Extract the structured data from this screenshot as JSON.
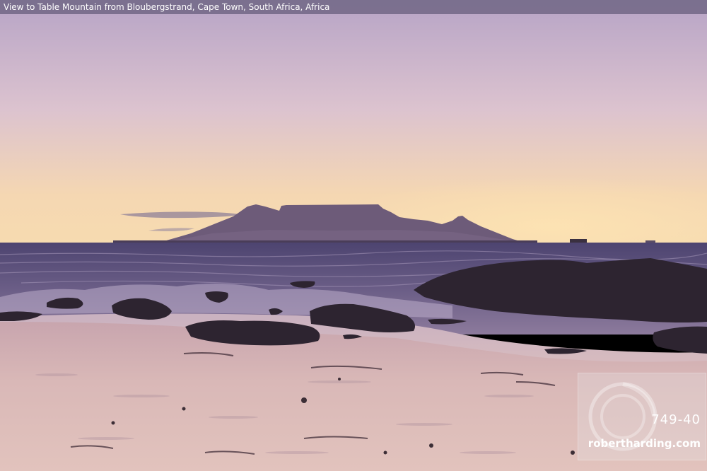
{
  "caption": {
    "text": "View to Table Mountain from Bloubergstrand, Cape Town, South Africa, Africa"
  },
  "watermark": {
    "code": "749-40",
    "site": "robertharding.com"
  },
  "colors": {
    "sky_top": "#b9a7c8",
    "sky_horizon": "#f7d8a8",
    "mountain": "#6c5a78",
    "sea": "#5a4f75",
    "sand": "#d9b6b6",
    "rock": "#2e2530"
  }
}
